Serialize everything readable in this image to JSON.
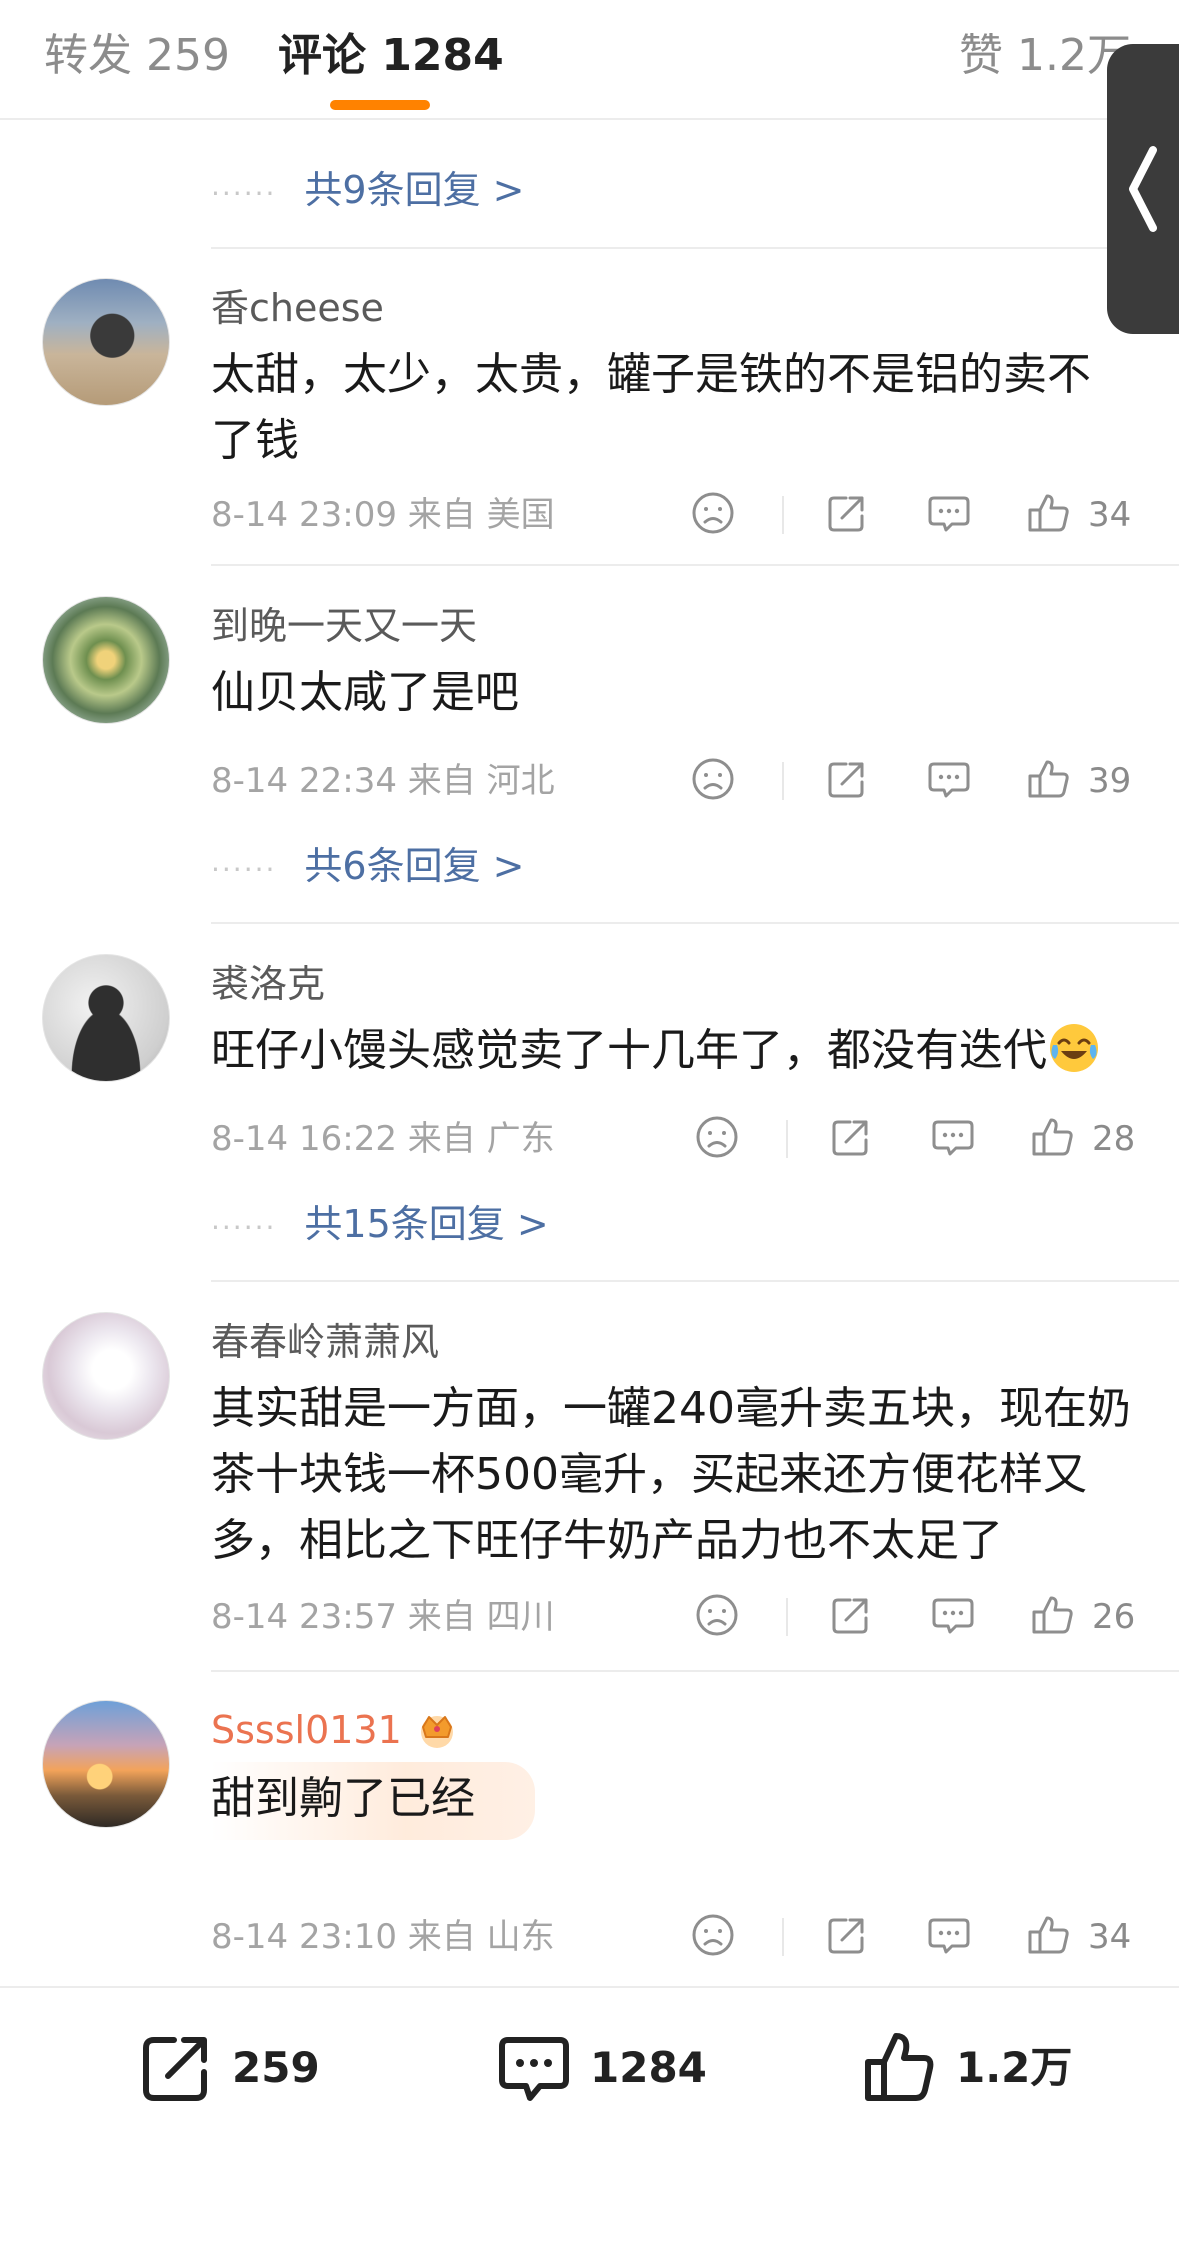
{
  "tabs": {
    "repost": "转发 259",
    "comments": "评论 1284",
    "likes": "赞 1.2万"
  },
  "top_reply_link": "共9条回复 >",
  "comments": [
    {
      "username": "香cheese",
      "text": "太甜，太少，太贵，罐子是铁的不是铝的卖不了钱",
      "meta": "8-14 23:09 来自 美国",
      "likes": "34"
    },
    {
      "username": "到晚一天又一天",
      "text": "仙贝太咸了是吧",
      "meta": "8-14 22:34 来自 河北",
      "likes": "39",
      "replies": "共6条回复 >"
    },
    {
      "username": "裘洛克",
      "text": "旺仔小馒头感觉卖了十几年了，都没有迭代",
      "meta": "8-14 16:22 来自 广东",
      "likes": "28",
      "replies": "共15条回复 >"
    },
    {
      "username": "春春岭萧萧风",
      "text": "其实甜是一方面，一罐240毫升卖五块，现在奶茶十块钱一杯500毫升，买起来还方便花样又多，相比之下旺仔牛奶产品力也不太足了",
      "meta": "8-14 23:57 来自 四川",
      "likes": "26"
    },
    {
      "username": "Ssssl0131",
      "text": "甜到齁了已经",
      "meta": "8-14 23:10 来自 山东",
      "likes": "34"
    }
  ],
  "bottom_bar": {
    "repost": "259",
    "comment": "1284",
    "like": "1.2万"
  },
  "colors": {
    "accent": "#ff8200",
    "link": "#4d6fa3",
    "vip_name": "#eb7350",
    "meta": "#a4a4a4"
  }
}
